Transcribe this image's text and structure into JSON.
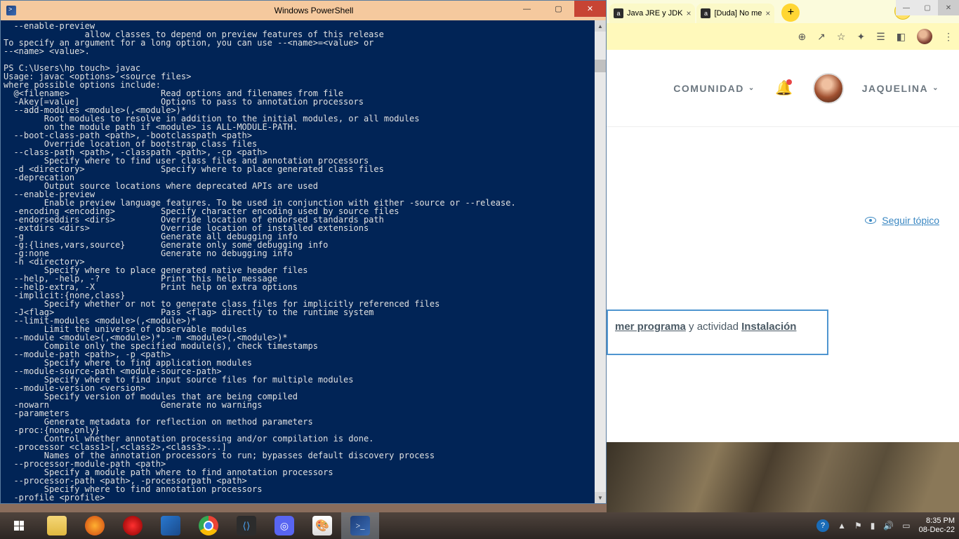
{
  "powershell": {
    "title": "Windows PowerShell",
    "content": "  --enable-preview\n                allow classes to depend on preview features of this release\nTo specify an argument for a long option, you can use --<name>=<value> or\n--<name> <value>.\n\nPS C:\\Users\\hp touch> javac\nUsage: javac <options> <source files>\nwhere possible options include:\n  @<filename>                  Read options and filenames from file\n  -Akey[=value]                Options to pass to annotation processors\n  --add-modules <module>(,<module>)*\n        Root modules to resolve in addition to the initial modules, or all modules\n        on the module path if <module> is ALL-MODULE-PATH.\n  --boot-class-path <path>, -bootclasspath <path>\n        Override location of bootstrap class files\n  --class-path <path>, -classpath <path>, -cp <path>\n        Specify where to find user class files and annotation processors\n  -d <directory>               Specify where to place generated class files\n  -deprecation\n        Output source locations where deprecated APIs are used\n  --enable-preview\n        Enable preview language features. To be used in conjunction with either -source or --release.\n  -encoding <encoding>         Specify character encoding used by source files\n  -endorseddirs <dirs>         Override location of endorsed standards path\n  -extdirs <dirs>              Override location of installed extensions\n  -g                           Generate all debugging info\n  -g:{lines,vars,source}       Generate only some debugging info\n  -g:none                      Generate no debugging info\n  -h <directory>\n        Specify where to place generated native header files\n  --help, -help, -?            Print this help message\n  --help-extra, -X             Print help on extra options\n  -implicit:{none,class}\n        Specify whether or not to generate class files for implicitly referenced files\n  -J<flag>                     Pass <flag> directly to the runtime system\n  --limit-modules <module>(,<module>)*\n        Limit the universe of observable modules\n  --module <module>(,<module>)*, -m <module>(,<module>)*\n        Compile only the specified module(s), check timestamps\n  --module-path <path>, -p <path>\n        Specify where to find application modules\n  --module-source-path <module-source-path>\n        Specify where to find input source files for multiple modules\n  --module-version <version>\n        Specify version of modules that are being compiled\n  -nowarn                      Generate no warnings\n  -parameters\n        Generate metadata for reflection on method parameters\n  -proc:{none,only}\n        Control whether annotation processing and/or compilation is done.\n  -processor <class1>[,<class2>,<class3>...]\n        Names of the annotation processors to run; bypasses default discovery process\n  --processor-module-path <path>\n        Specify a module path where to find annotation processors\n  --processor-path <path>, -processorpath <path>\n        Specify where to find annotation processors\n  -profile <profile>"
  },
  "browser": {
    "tabs": [
      {
        "label": "Java JRE y JDK"
      },
      {
        "label": "[Duda] No me"
      }
    ],
    "nav": {
      "comunidad": "COMUNIDAD",
      "username": "JAQUELINA"
    },
    "follow": "Seguir tópico",
    "content_links": {
      "link1": "mer programa",
      "mid": " y actividad ",
      "link2": "Instalación"
    }
  },
  "taskbar": {
    "time": "8:35 PM",
    "date": "08-Dec-22"
  }
}
